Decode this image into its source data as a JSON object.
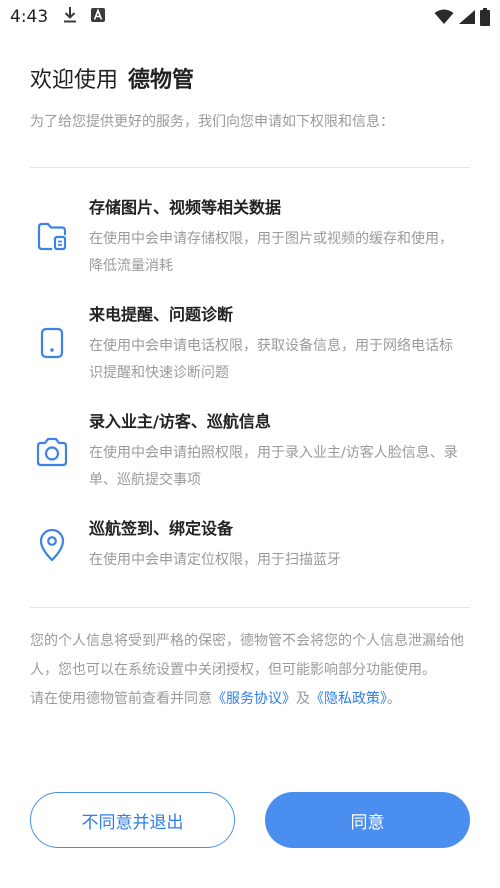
{
  "status_bar": {
    "time": "4:43",
    "icons": [
      "download-icon",
      "font-a-icon",
      "wifi-icon",
      "signal-icon",
      "battery-icon"
    ]
  },
  "header": {
    "welcome_prefix": "欢迎使用",
    "app_name": "德物管",
    "subtitle": "为了给您提供更好的服务，我们向您申请如下权限和信息："
  },
  "permissions": [
    {
      "icon": "folder-icon",
      "title": "存储图片、视频等相关数据",
      "description": "在使用中会申请存储权限，用于图片或视频的缓存和使用，降低流量消耗"
    },
    {
      "icon": "phone-icon",
      "title": "来电提醒、问题诊断",
      "description": "在使用中会申请电话权限，获取设备信息，用于网络电话标识提醒和快速诊断问题"
    },
    {
      "icon": "camera-icon",
      "title": "录入业主/访客、巡航信息",
      "description": "在使用中会申请拍照权限，用于录入业主/访客人脸信息、录单、巡航提交事项"
    },
    {
      "icon": "location-pin-icon",
      "title": "巡航签到、绑定设备",
      "description": "在使用中会申请定位权限，用于扫描蓝牙"
    }
  ],
  "notice": {
    "paragraph": "您的个人信息将受到严格的保密，德物管不会将您的个人信息泄漏给他人，您也可以在系统设置中关闭授权，但可能影响部分功能使用。",
    "agreement_prefix": "请在使用德物管前查看并同意",
    "service_link": "《服务协议》",
    "and_text": "及",
    "privacy_link": "《隐私政策》",
    "period": "。"
  },
  "buttons": {
    "disagree_label": "不同意并退出",
    "agree_label": "同意"
  },
  "colors": {
    "accent": "#4a8ff0",
    "link": "#2f7de6",
    "secondary_text": "#9a9a9a",
    "primary_text": "#222222"
  }
}
